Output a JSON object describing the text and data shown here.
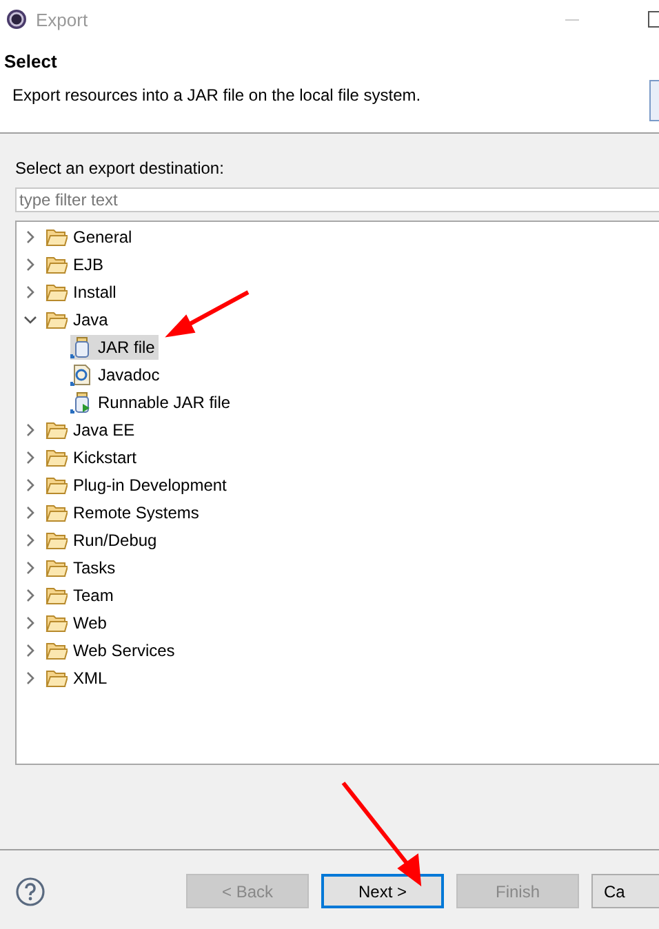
{
  "window": {
    "title": "Export"
  },
  "header": {
    "title": "Select",
    "description": "Export resources into a JAR file on the local file system."
  },
  "destination": {
    "label": "Select an export destination:",
    "placeholder": "type filter text"
  },
  "tree": [
    {
      "label": "General",
      "kind": "folder",
      "expanded": false
    },
    {
      "label": "EJB",
      "kind": "folder",
      "expanded": false
    },
    {
      "label": "Install",
      "kind": "folder",
      "expanded": false
    },
    {
      "label": "Java",
      "kind": "folder",
      "expanded": true,
      "children": [
        {
          "label": "JAR file",
          "kind": "jar",
          "selected": true
        },
        {
          "label": "Javadoc",
          "kind": "javadoc",
          "selected": false
        },
        {
          "label": "Runnable JAR file",
          "kind": "runnable",
          "selected": false
        }
      ]
    },
    {
      "label": "Java EE",
      "kind": "folder",
      "expanded": false
    },
    {
      "label": "Kickstart",
      "kind": "folder",
      "expanded": false
    },
    {
      "label": "Plug-in Development",
      "kind": "folder",
      "expanded": false
    },
    {
      "label": "Remote Systems",
      "kind": "folder",
      "expanded": false
    },
    {
      "label": "Run/Debug",
      "kind": "folder",
      "expanded": false
    },
    {
      "label": "Tasks",
      "kind": "folder",
      "expanded": false
    },
    {
      "label": "Team",
      "kind": "folder",
      "expanded": false
    },
    {
      "label": "Web",
      "kind": "folder",
      "expanded": false
    },
    {
      "label": "Web Services",
      "kind": "folder",
      "expanded": false
    },
    {
      "label": "XML",
      "kind": "folder",
      "expanded": false
    }
  ],
  "buttons": [
    {
      "label": "< Back",
      "disabled": true,
      "default": false
    },
    {
      "label": "Next >",
      "disabled": false,
      "default": true
    },
    {
      "label": "Finish",
      "disabled": true,
      "default": false
    },
    {
      "label": "Ca",
      "disabled": false,
      "default": false
    }
  ]
}
